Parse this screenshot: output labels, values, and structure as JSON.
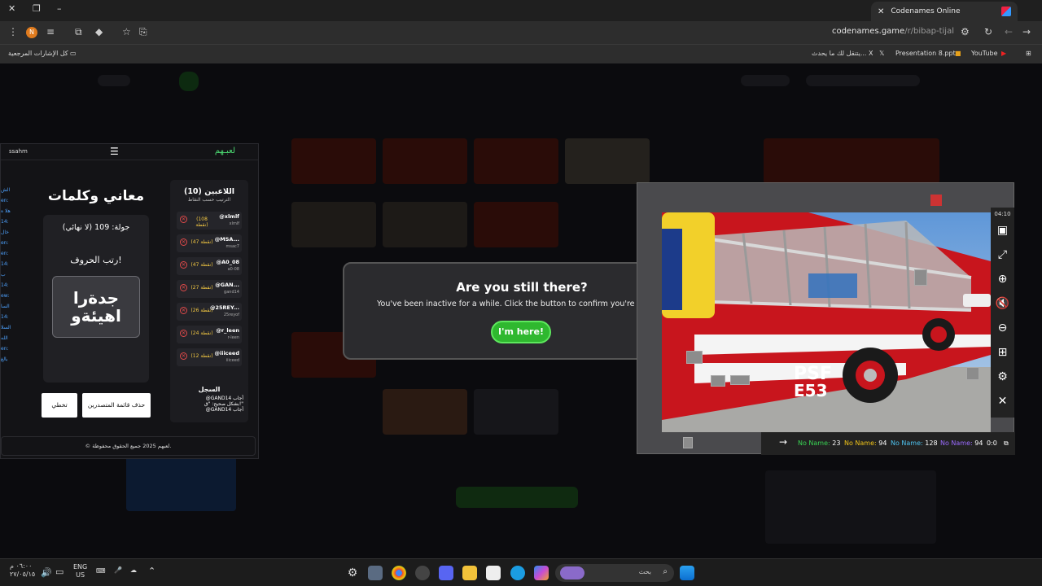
{
  "browser": {
    "tab_title": "Codenames Online",
    "url_host": "codenames.game",
    "url_path": "/r/bibap-tijal",
    "avatar_letter": "N",
    "bookmarks": {
      "all": "كل الإشارات المرجعية",
      "x_item": "يتنقل لك ما يحدث... X",
      "pptx": "Presentation 8.pptx",
      "youtube": "YouTube"
    }
  },
  "panel": {
    "logo": "لعبـهم",
    "user": "ssahm",
    "title": "معاني وكلمات",
    "round": "جولة: 109 (لا نهائي)",
    "order": "رتب الحروف!",
    "letters": "جدةرا اهيئةو",
    "skip_button": "تخطي",
    "delete_leaderboard_button": "حذف قائمة المتصدرين",
    "players_title": "اللاعبين (10)",
    "players_subtitle": "الترتيب حسب النقاط",
    "players": [
      {
        "name": "@xlmlf",
        "handle": "xlmlf",
        "points": "(108 نقطة)"
      },
      {
        "name": "@MSA...",
        "handle": "msac7",
        "points": "(47 نقطة)"
      },
      {
        "name": "@A0_08",
        "handle": "a0-08",
        "points": "(47 نقطة)"
      },
      {
        "name": "@GAN...",
        "handle": "gand14",
        "points": "(27 نقطة)"
      },
      {
        "name": "@25REY...",
        "handle": "25reyof",
        "points": "(26 نقطة)"
      },
      {
        "name": "@r_leen",
        "handle": "r-leen",
        "points": "(24 نقطة)"
      },
      {
        "name": "@iiiceed",
        "handle": "iiiceed",
        "points": "(12 نقطة)"
      }
    ],
    "log_title": "السجل",
    "log_line1": "@GAND14 أجاب",
    "log_line2": "بشكل صحيح: \"ق!\"",
    "log_line3": "@GAND14 أجاب",
    "left_fragments": [
      "الش",
      "en:",
      "هلا ه",
      "14:",
      "خال",
      "en:",
      "en:",
      "14: ب",
      "14:",
      "ew:",
      "السا",
      "14:",
      "السلا",
      "الله",
      "en:",
      "بالغ"
    ],
    "footer": "© لعبهم 2025 جميع الحقوق محفوظة."
  },
  "modal": {
    "title": "Are you still there?",
    "message": "You've been inactive for a while. Click the button to confirm you're still p",
    "button": "I'm here!"
  },
  "puzzle": {
    "timer": "04:10",
    "truck_text": "PSF E53",
    "scores": [
      {
        "label": "No Name:",
        "value": "23",
        "color": "#39d353"
      },
      {
        "label": "No Name:",
        "value": "94",
        "color": "#f0c419"
      },
      {
        "label": "No Name:",
        "value": "128",
        "color": "#4ec3f0"
      },
      {
        "label": "No Name:",
        "value": "94",
        "color": "#9b6bff"
      }
    ],
    "pieces_count": "0:0"
  },
  "taskbar": {
    "time": "٠٦:٠٠ م",
    "date": "٢٧/٠٥/١٥",
    "lang": "ENG",
    "region": "US",
    "search_placeholder": "بحث"
  }
}
